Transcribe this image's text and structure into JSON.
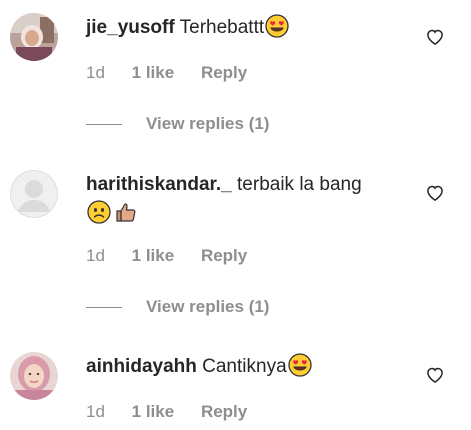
{
  "comments": [
    {
      "username": "jie_yusoff",
      "text": "Terhebattt",
      "emoji": [
        "heart-eyes"
      ],
      "time": "1d",
      "likes": "1 like",
      "reply_label": "Reply",
      "view_replies": "View replies (1)"
    },
    {
      "username": "harithiskandar._",
      "text": "terbaik la bang",
      "emoji": [
        "slightly-frowning-face",
        "thumbs-up"
      ],
      "time": "1d",
      "likes": "1 like",
      "reply_label": "Reply",
      "view_replies": "View replies (1)"
    },
    {
      "username": "ainhidayahh",
      "text": "Cantiknya",
      "emoji": [
        "heart-eyes"
      ],
      "time": "1d",
      "likes": "1 like",
      "reply_label": "Reply"
    }
  ],
  "colors": {
    "text": "#262626",
    "secondary": "#8e8e8e",
    "emoji_yellow": "#ffcc33",
    "heart_eyes": "#e8253c"
  }
}
